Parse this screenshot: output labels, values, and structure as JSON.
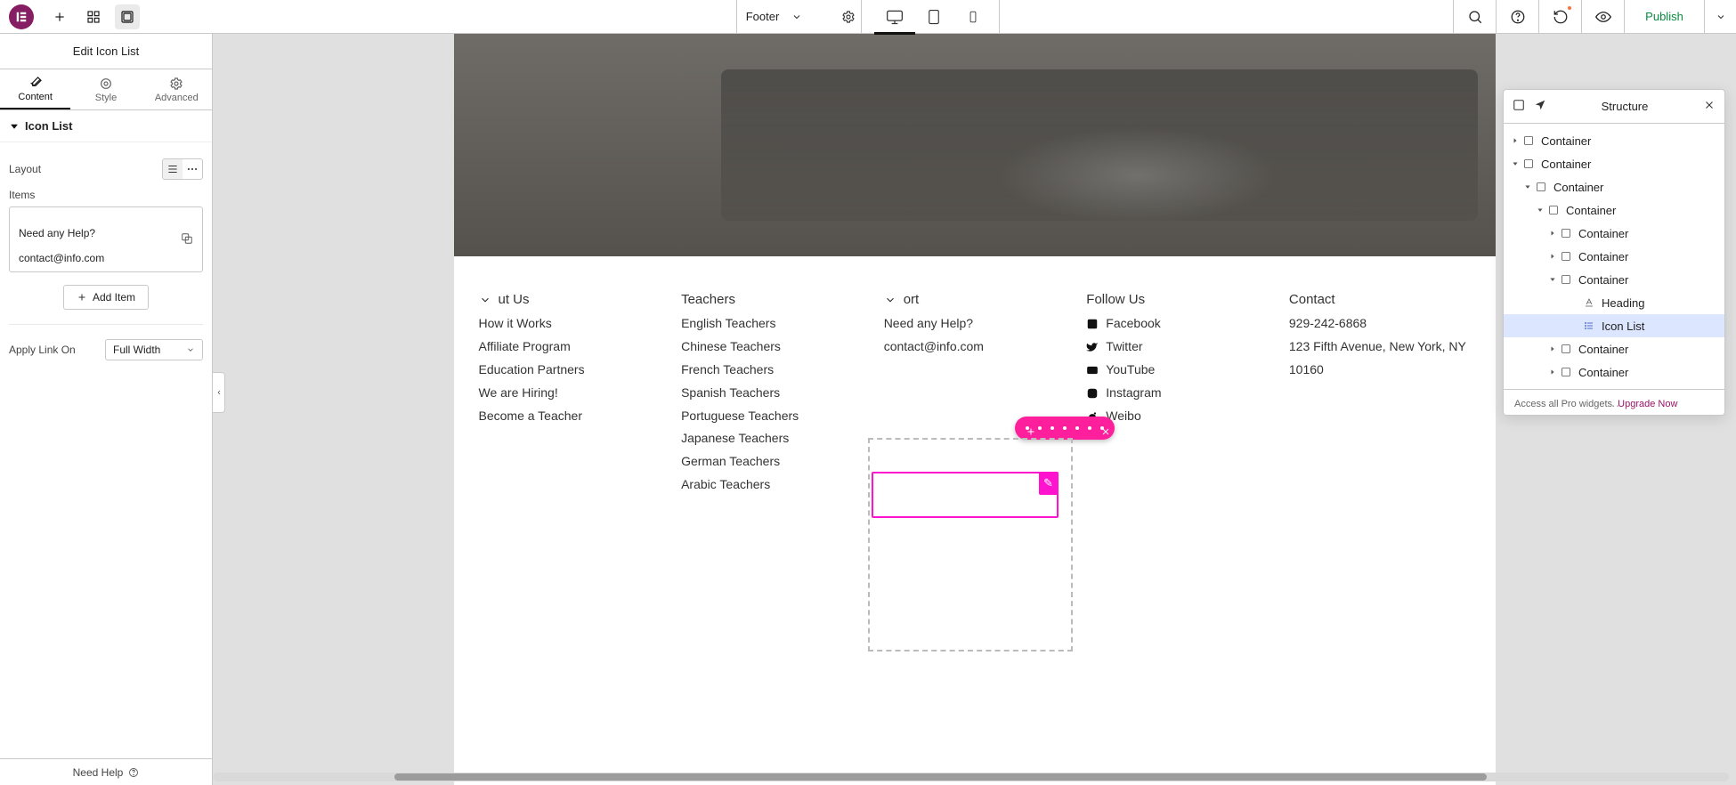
{
  "topbar": {
    "title": "Footer",
    "publish": "Publish"
  },
  "sidebar": {
    "title": "Edit Icon List",
    "tabs": {
      "content": "Content",
      "style": "Style",
      "advanced": "Advanced"
    },
    "section_title": "Icon List",
    "layout_label": "Layout",
    "items_label": "Items",
    "item0_line1": "Need any Help?",
    "item0_line2": "contact@info.com",
    "add_item": "Add Item",
    "apply_link_label": "Apply Link On",
    "apply_link_value": "Full Width",
    "need_help": "Need Help"
  },
  "structure": {
    "title": "Structure",
    "upgrade_text": "Access all Pro widgets.",
    "upgrade_link": "Upgrade Now",
    "tree": {
      "c0": "Container",
      "c1": "Container",
      "c2": "Container",
      "c3": "Container",
      "c4": "Container",
      "c5": "Container",
      "c6": "Container",
      "heading": "Heading",
      "iconlist": "Icon List",
      "c7": "Container",
      "c8": "Container"
    }
  },
  "footer": {
    "about": {
      "head": "ut Us",
      "items": [
        "How it Works",
        "Affiliate Program",
        "Education Partners",
        "We are Hiring!",
        "Become a Teacher"
      ]
    },
    "teachers": {
      "head": "Teachers",
      "items": [
        "English Teachers",
        "Chinese Teachers",
        "French Teachers",
        "Spanish Teachers",
        "Portuguese Teachers",
        "Japanese Teachers",
        "German Teachers",
        "Arabic Teachers"
      ]
    },
    "support": {
      "head": "ort",
      "line1": "Need any Help?",
      "line2": "contact@info.com"
    },
    "follow": {
      "head": "Follow Us",
      "items": [
        "Facebook",
        "Twitter",
        "YouTube",
        "Instagram",
        "Weibo"
      ]
    },
    "contact": {
      "head": "Contact",
      "phone": "929-242-6868",
      "addr": "123 Fifth Avenue, New York, NY 10160"
    }
  }
}
